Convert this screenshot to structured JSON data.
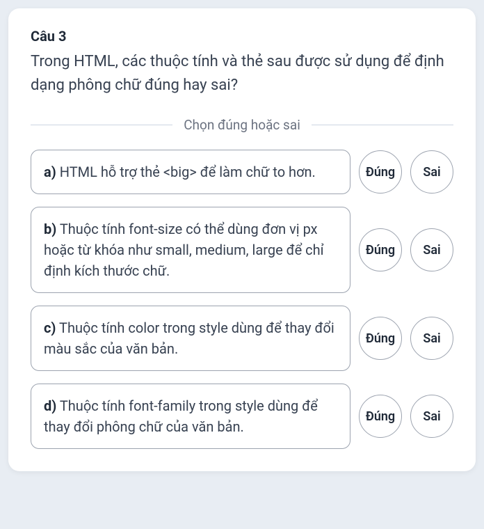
{
  "question": {
    "title": "Câu 3",
    "text": "Trong HTML, các thuộc tính và thẻ sau được sử dụng để định dạng phông chữ đúng hay sai?"
  },
  "instruction": "Chọn đúng hoặc sai",
  "choices": {
    "true_label": "Đúng",
    "false_label": "Sai"
  },
  "options": [
    {
      "label": "a)",
      "text": "HTML hỗ trợ thẻ <big> để làm chữ to hơn."
    },
    {
      "label": "b)",
      "text": "Thuộc tính font-size có thể dùng đơn vị px hoặc từ khóa như small, medium, large để chỉ định kích thước chữ."
    },
    {
      "label": "c)",
      "text": "Thuộc tính color trong style dùng để thay đổi màu sắc của văn bản."
    },
    {
      "label": "d)",
      "text": "Thuộc tính font-family trong style dùng để thay đổi phông chữ của văn bản."
    }
  ]
}
